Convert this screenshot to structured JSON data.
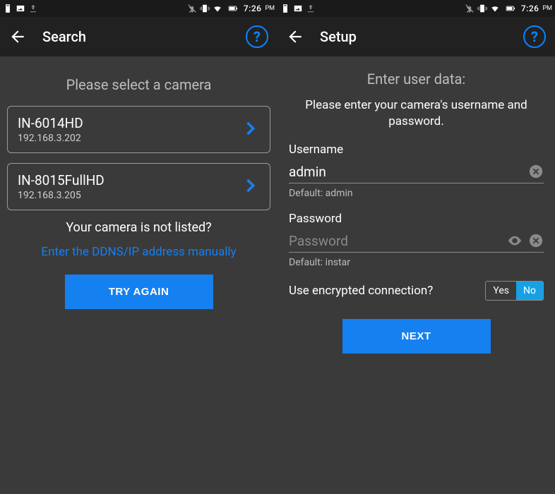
{
  "status": {
    "time": "7:26",
    "ampm": "PM"
  },
  "left": {
    "title": "Search",
    "subhead": "Please select a camera",
    "cameras": [
      {
        "name": "IN-6014HD",
        "ip": "192.168.3.202"
      },
      {
        "name": "IN-8015FullHD",
        "ip": "192.168.3.205"
      }
    ],
    "not_listed": "Your camera is not listed?",
    "manual_link": "Enter the DDNS/IP address manually",
    "try_again": "TRY AGAIN"
  },
  "right": {
    "title": "Setup",
    "head": "Enter user data:",
    "sub": "Please enter your camera's username and password.",
    "username_label": "Username",
    "username_value": "admin",
    "username_hint": "Default: admin",
    "password_label": "Password",
    "password_placeholder": "Password",
    "password_hint": "Default: instar",
    "encrypted_label": "Use encrypted connection?",
    "toggle_yes": "Yes",
    "toggle_no": "No",
    "next": "NEXT"
  }
}
